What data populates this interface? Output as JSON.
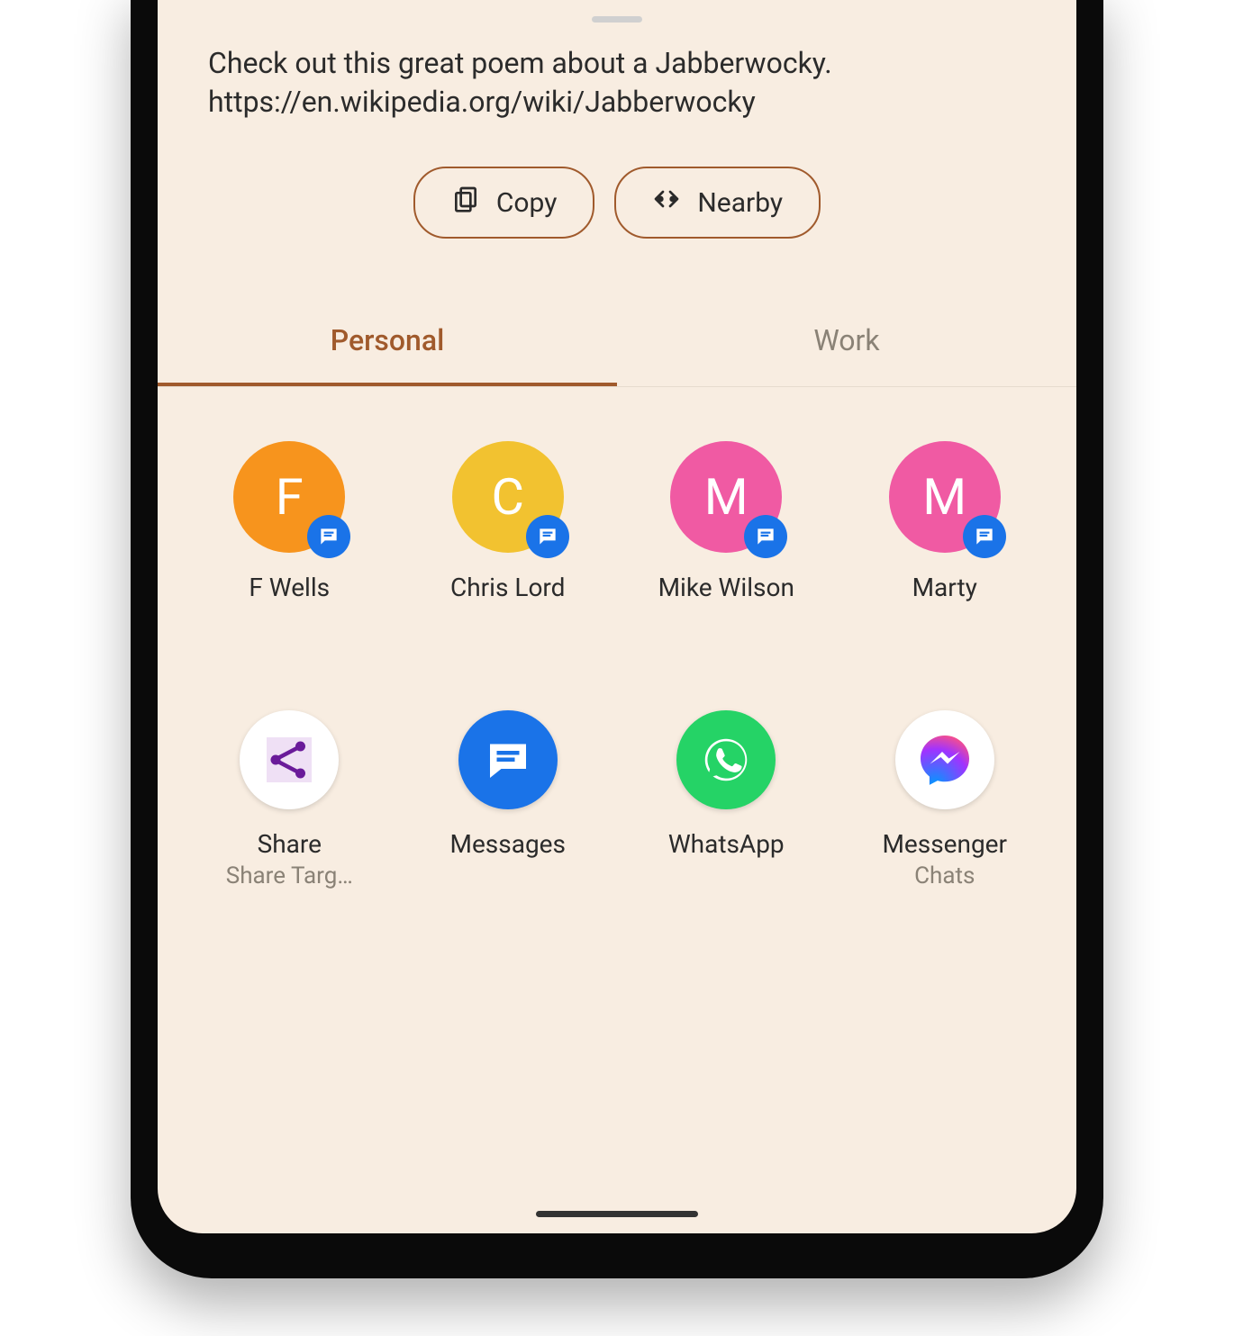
{
  "share_text_line1": "Check out this great poem about a Jabberwocky.",
  "share_text_line2": "https://en.wikipedia.org/wiki/Jabberwocky",
  "actions": {
    "copy": "Copy",
    "nearby": "Nearby"
  },
  "tabs": {
    "personal": "Personal",
    "work": "Work"
  },
  "contacts": [
    {
      "initial": "F",
      "label": "F Wells",
      "color": "#f7941d"
    },
    {
      "initial": "C",
      "label": "Chris Lord",
      "color": "#f2c230"
    },
    {
      "initial": "M",
      "label": "Mike Wilson",
      "color": "#f05aa3"
    },
    {
      "initial": "M",
      "label": "Marty",
      "color": "#f05aa3"
    }
  ],
  "apps": [
    {
      "label": "Share",
      "sublabel": "Share Targ…"
    },
    {
      "label": "Messages",
      "sublabel": ""
    },
    {
      "label": "WhatsApp",
      "sublabel": ""
    },
    {
      "label": "Messenger",
      "sublabel": "Chats"
    }
  ]
}
